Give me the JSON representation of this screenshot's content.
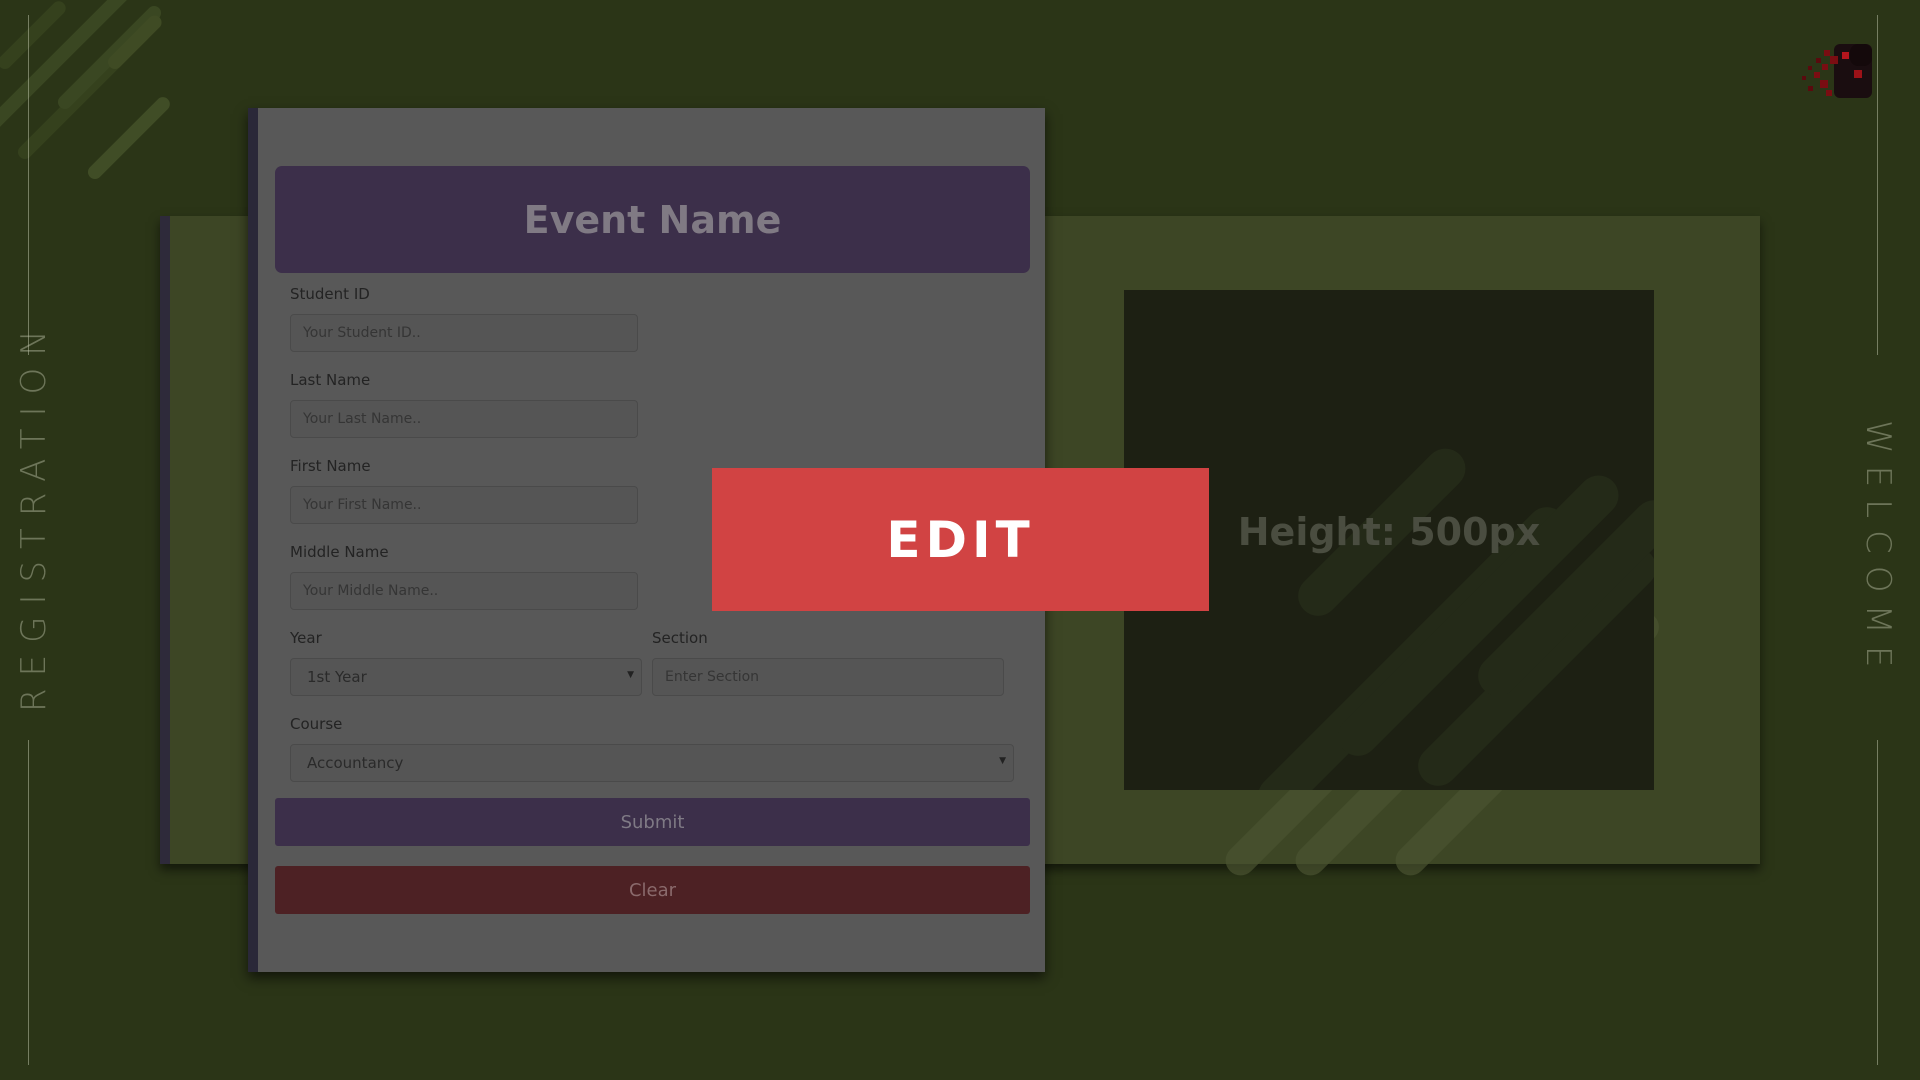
{
  "side_labels": {
    "left": "REGISTRATION",
    "right": "WELCOME"
  },
  "logo": {
    "icon": "pixel-b-logo",
    "colors": [
      "#7a0d12",
      "#1a0d10",
      "#b3151d"
    ]
  },
  "form": {
    "title": "Event Name",
    "fields": {
      "student_id": {
        "label": "Student ID",
        "placeholder": "Your Student ID.."
      },
      "last_name": {
        "label": "Last Name",
        "placeholder": "Your Last Name.."
      },
      "first_name": {
        "label": "First Name",
        "placeholder": "Your First Name.."
      },
      "middle_name": {
        "label": "Middle Name",
        "placeholder": "Your Middle Name.."
      },
      "year": {
        "label": "Year",
        "value": "1st Year"
      },
      "section": {
        "label": "Section",
        "placeholder": "Enter Section"
      },
      "course": {
        "label": "Course",
        "value": "Accountancy"
      }
    },
    "submit_label": "Submit",
    "clear_label": "Clear"
  },
  "preview": {
    "label": "Height: 500px"
  },
  "overlay": {
    "label": "EDIT"
  },
  "colors": {
    "background": "#2b3517",
    "form_accent": "#3c2f4a",
    "clear_button": "#4d2124",
    "edit_banner": "#d14343"
  }
}
